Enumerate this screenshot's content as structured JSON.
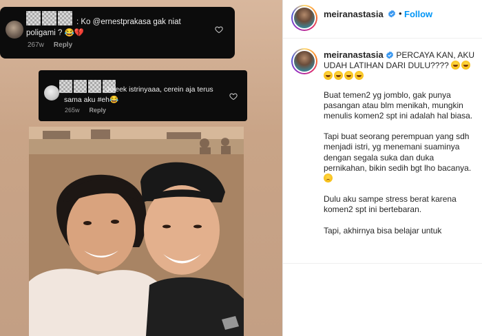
{
  "left": {
    "comment1": {
      "text": ": Ko @ernestprakasa gak niat poligami ? 😂💔",
      "time": "267w",
      "reply": "Reply"
    },
    "comment2": {
      "text": ": Jeleek istrinyaaa, cerein aja terus sama aku #eh😂",
      "time": "265w",
      "reply": "Reply"
    }
  },
  "header": {
    "username": "meiranastasia",
    "dot": "•",
    "follow": "Follow"
  },
  "caption": {
    "username": "meiranastasia",
    "headline": "PERCAYA KAN, AKU UDAH LATIHAN DARI DULU????",
    "p1": "Buat temen2 yg jomblo, gak punya pasangan atau blm menikah, mungkin menulis komen2 spt ini adalah hal biasa.",
    "p2": "Tapi buat seorang perempuan yang sdh menjadi istri, yg menemani suaminya dengan segala suka dan duka pernikahan, bikin sedih bgt lho bacanya.",
    "p3": "Dulu aku sampe stress berat karena komen2 spt ini bertebaran.",
    "p4": "Tapi, akhirnya bisa belajar untuk"
  },
  "colors": {
    "follow_blue": "#0095f6",
    "verified_blue": "#3897f0",
    "text_dark": "#262626"
  },
  "icons": [
    "heart-outline-icon",
    "verified-badge-icon",
    "laughing-emoji-icon",
    "sad-emoji-icon"
  ]
}
